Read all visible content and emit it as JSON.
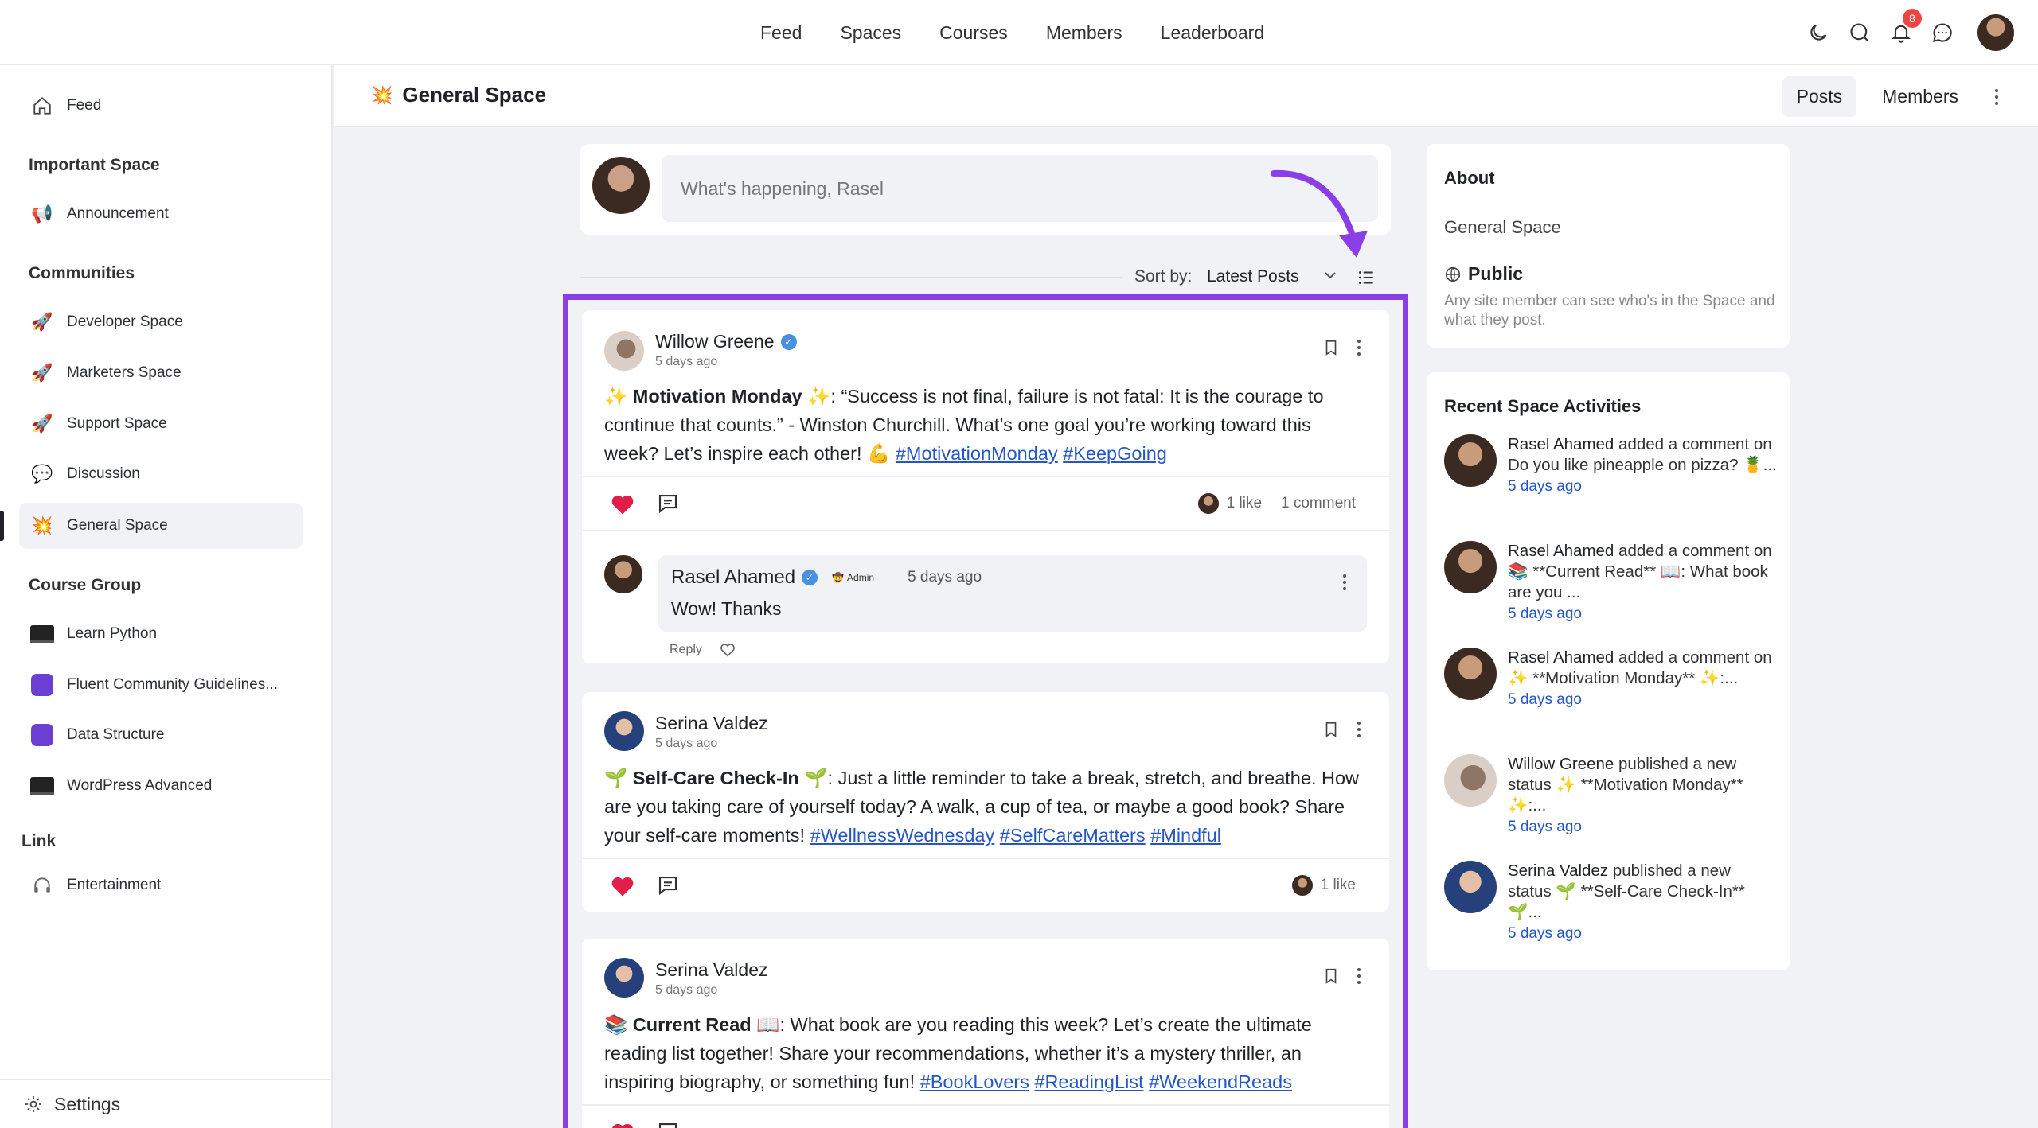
{
  "topnav": {
    "items": [
      "Feed",
      "Spaces",
      "Courses",
      "Members",
      "Leaderboard"
    ],
    "notification_count": "8"
  },
  "sidebar": {
    "feed": "Feed",
    "important_head": "Important Space",
    "announcement": "Announcement",
    "communities_head": "Communities",
    "communities": [
      "Developer Space",
      "Marketers Space",
      "Support Space",
      "Discussion",
      "General Space"
    ],
    "course_head": "Course Group",
    "courses": [
      "Learn Python",
      "Fluent Community Guidelines...",
      "Data Structure",
      "WordPress Advanced"
    ],
    "link_head": "Link",
    "links": [
      "Entertainment"
    ],
    "settings": "Settings"
  },
  "space": {
    "title": "General Space",
    "tabs": [
      "Posts",
      "Members"
    ]
  },
  "composer": {
    "placeholder": "What's happening, Rasel"
  },
  "sort": {
    "label": "Sort by:",
    "value": "Latest Posts"
  },
  "posts": [
    {
      "author": "Willow Greene",
      "time": "5 days ago",
      "title": "Motivation Monday",
      "body": ": “Success is not final, failure is not fatal: It is the courage to continue that counts.” - Winston Churchill. What’s one goal you’re working toward this week? Let’s inspire each other! 💪",
      "tags": [
        "#MotivationMonday",
        "#KeepGoing"
      ],
      "likes": "1 like",
      "comments": "1 comment",
      "comment": {
        "author": "Rasel Ahamed",
        "role": "Admin",
        "time": "5 days ago",
        "text": "Wow! Thanks",
        "reply": "Reply"
      }
    },
    {
      "author": "Serina Valdez",
      "time": "5 days ago",
      "title": "Self-Care Check-In",
      "body": ": Just a little reminder to take a break, stretch, and breathe. How are you taking care of yourself today? A walk, a cup of tea, or maybe a good book? Share your self-care moments!",
      "tags": [
        "#WellnessWednesday",
        "#SelfCareMatters",
        "#Mindful"
      ],
      "likes": "1 like"
    },
    {
      "author": "Serina Valdez",
      "time": "5 days ago",
      "title": "Current Read",
      "body": ": What book are you reading this week? Let’s create the ultimate reading list together! Share your recommendations, whether it’s a mystery thriller, an inspiring biography, or something fun!",
      "tags": [
        "#BookLovers",
        "#ReadingList",
        "#WeekendReads"
      ]
    }
  ],
  "about": {
    "heading": "About",
    "name": "General Space",
    "privacy": "Public",
    "description": "Any site member can see who's in the Space and what they post."
  },
  "recent": {
    "heading": "Recent Space Activities",
    "items": [
      {
        "name": "Rasel Ahamed",
        "text": " added a comment on Do you like pineapple on pizza? 🍍...",
        "time": "5 days ago"
      },
      {
        "name": "Rasel Ahamed",
        "text": " added a comment on 📚 **Current Read** 📖: What book are you ...",
        "time": "5 days ago"
      },
      {
        "name": "Rasel Ahamed",
        "text": " added a comment on ✨ **Motivation Monday** ✨:...",
        "time": "5 days ago"
      },
      {
        "name": "Willow Greene",
        "text": " published a new status ✨ **Motivation Monday** ✨:...",
        "time": "5 days ago"
      },
      {
        "name": "Serina Valdez",
        "text": " published a new status 🌱 **Self-Care Check-In** 🌱...",
        "time": "5 days ago"
      }
    ]
  },
  "colors": {
    "accent": "#8a3ee8",
    "link": "#2456c8",
    "heart": "#e11d48",
    "badge": "#ef4444"
  }
}
